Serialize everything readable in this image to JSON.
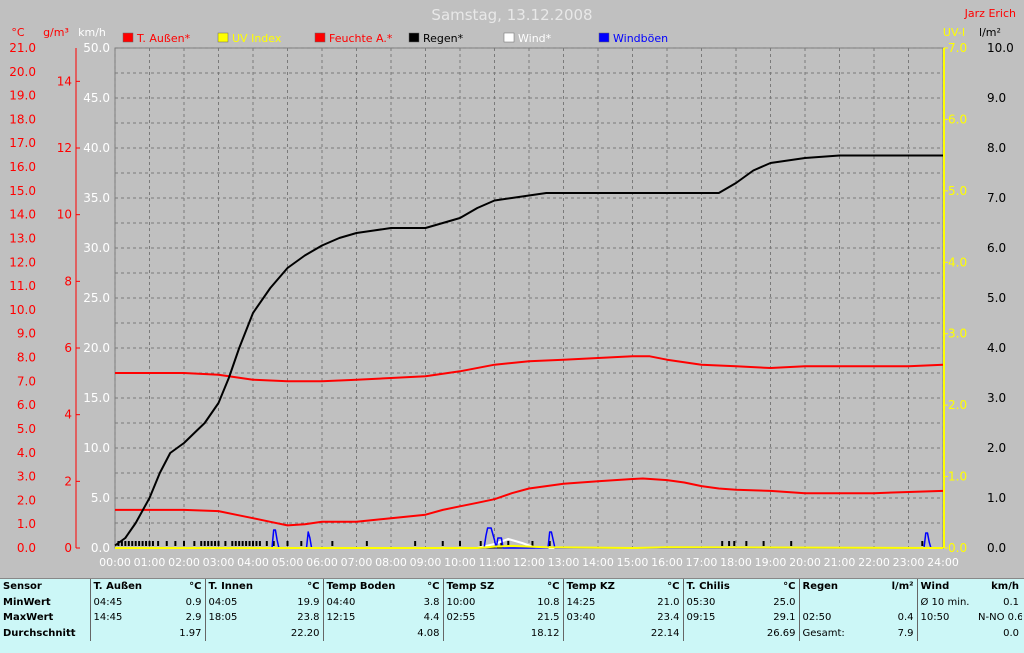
{
  "chart_data": {
    "type": "line",
    "title": "Samstag, 13.12.2008",
    "author": "Jarz Erich",
    "x_ticks": [
      "00:00",
      "01:00",
      "02:00",
      "03:00",
      "04:00",
      "05:00",
      "06:00",
      "07:00",
      "08:00",
      "09:00",
      "10:00",
      "11:00",
      "12:00",
      "13:00",
      "14:00",
      "15:00",
      "16:00",
      "17:00",
      "18:00",
      "19:00",
      "20:00",
      "21:00",
      "22:00",
      "23:00",
      "24:00"
    ],
    "xlim": [
      0,
      24
    ],
    "axes": {
      "temp": {
        "unit": "°C",
        "ylim": [
          0,
          21
        ],
        "ticks": [
          "0.0",
          "1.0",
          "2.0",
          "3.0",
          "4.0",
          "5.0",
          "6.0",
          "7.0",
          "8.0",
          "9.0",
          "10.0",
          "11.0",
          "12.0",
          "13.0",
          "14.0",
          "15.0",
          "16.0",
          "17.0",
          "18.0",
          "19.0",
          "20.0",
          "21.0"
        ],
        "color": "#ff0000"
      },
      "humidity": {
        "unit": "g/m³",
        "ylim": [
          0,
          15
        ],
        "ticks": [
          "0",
          "2",
          "4",
          "6",
          "8",
          "10",
          "12",
          "14"
        ],
        "color": "#ff0000"
      },
      "wind": {
        "unit": "km/h",
        "ylim": [
          0,
          50
        ],
        "ticks": [
          "0.0",
          "5.0",
          "10.0",
          "15.0",
          "20.0",
          "25.0",
          "30.0",
          "35.0",
          "40.0",
          "45.0",
          "50.0"
        ],
        "color": "#ffffff"
      },
      "uv": {
        "unit": "UV-I",
        "ylim": [
          0,
          7
        ],
        "ticks": [
          "0.0",
          "1.0",
          "2.0",
          "3.0",
          "4.0",
          "5.0",
          "6.0",
          "7.0"
        ],
        "color": "#ffff00"
      },
      "rain": {
        "unit": "l/m²",
        "ylim": [
          0,
          10
        ],
        "ticks": [
          "0.0",
          "1.0",
          "2.0",
          "3.0",
          "4.0",
          "5.0",
          "6.0",
          "7.0",
          "8.0",
          "9.0",
          "10.0"
        ],
        "color": "#000000"
      }
    },
    "legend": [
      "T. Außen*",
      "UV Index",
      "Feuchte A.*",
      "Regen*",
      "Wind*",
      "Windböen"
    ],
    "series": [
      {
        "name": "T. Außen*",
        "color": "#ff0000",
        "axis": "temp",
        "x": [
          0,
          1,
          2,
          3,
          3.5,
          4,
          4.5,
          5,
          5.5,
          6,
          7,
          8,
          9,
          9.5,
          10,
          10.5,
          11,
          11.5,
          12,
          12.5,
          13,
          14,
          15,
          15.3,
          16,
          16.5,
          17,
          17.5,
          18,
          19,
          20,
          21,
          22,
          23,
          24
        ],
        "y": [
          1.6,
          1.6,
          1.6,
          1.55,
          1.4,
          1.25,
          1.1,
          0.95,
          1.0,
          1.1,
          1.1,
          1.25,
          1.4,
          1.6,
          1.75,
          1.9,
          2.05,
          2.3,
          2.5,
          2.6,
          2.7,
          2.8,
          2.9,
          2.92,
          2.85,
          2.75,
          2.6,
          2.5,
          2.45,
          2.4,
          2.3,
          2.3,
          2.3,
          2.35,
          2.4
        ]
      },
      {
        "name": "Feuchte A.*",
        "color": "#ff0000",
        "axis": "humidity",
        "x": [
          0,
          1,
          2,
          3,
          4,
          5,
          6,
          7,
          8,
          9,
          10,
          11,
          12,
          13,
          14,
          15,
          15.5,
          16,
          17,
          18,
          19,
          20,
          21,
          22,
          23,
          24
        ],
        "y": [
          5.25,
          5.25,
          5.25,
          5.2,
          5.05,
          5.0,
          5.0,
          5.05,
          5.1,
          5.15,
          5.3,
          5.5,
          5.6,
          5.65,
          5.7,
          5.75,
          5.75,
          5.65,
          5.5,
          5.45,
          5.4,
          5.45,
          5.45,
          5.45,
          5.45,
          5.5
        ]
      },
      {
        "name": "Regen*",
        "color": "#000000",
        "axis": "rain",
        "x": [
          0,
          0.3,
          0.6,
          1.0,
          1.3,
          1.6,
          2.0,
          2.3,
          2.6,
          3.0,
          3.3,
          3.6,
          4.0,
          4.5,
          5.0,
          5.5,
          6.0,
          6.5,
          7.0,
          7.5,
          8.0,
          9.0,
          9.5,
          10.0,
          10.5,
          11.0,
          11.5,
          12.0,
          12.5,
          13.0,
          14.0,
          15.0,
          16.0,
          17.0,
          17.5,
          18.0,
          18.5,
          19.0,
          20.0,
          21.0,
          22.0,
          23.0,
          24.0
        ],
        "y": [
          0.05,
          0.2,
          0.5,
          1.0,
          1.5,
          1.9,
          2.1,
          2.3,
          2.5,
          2.9,
          3.4,
          4.0,
          4.7,
          5.2,
          5.6,
          5.85,
          6.05,
          6.2,
          6.3,
          6.35,
          6.4,
          6.4,
          6.5,
          6.6,
          6.8,
          6.95,
          7.0,
          7.05,
          7.1,
          7.1,
          7.1,
          7.1,
          7.1,
          7.1,
          7.1,
          7.3,
          7.55,
          7.7,
          7.8,
          7.85,
          7.85,
          7.85,
          7.85
        ]
      },
      {
        "name": "Wind*",
        "color": "#ffffff",
        "axis": "wind",
        "x": [
          0,
          10.5,
          11.0,
          11.4,
          11.8,
          12.2,
          24
        ],
        "y": [
          0,
          0,
          0.4,
          0.9,
          0.5,
          0,
          0
        ]
      },
      {
        "name": "Windböen",
        "color": "#0000ff",
        "axis": "wind",
        "x": [
          4.55,
          4.6,
          4.65,
          4.7,
          4.75,
          5.55,
          5.6,
          5.65,
          5.7,
          10.7,
          10.75,
          10.8,
          10.9,
          11.0,
          11.05,
          11.1,
          11.2,
          11.25,
          11.3,
          11.35,
          12.55,
          12.6,
          12.65,
          12.7,
          12.75,
          23.45,
          23.5,
          23.55,
          23.6,
          23.65
        ],
        "y": [
          0,
          1.8,
          1.8,
          0.8,
          0,
          0,
          1.6,
          1.0,
          0,
          0,
          1.2,
          2.0,
          2.0,
          0.8,
          0,
          1.0,
          1.0,
          0,
          0,
          0,
          0,
          1.6,
          1.6,
          0.8,
          0,
          0,
          1.5,
          1.5,
          0.6,
          0
        ]
      },
      {
        "name": "UV Index",
        "color": "#ffff00",
        "axis": "uv",
        "x": [
          0,
          10.5,
          11.0,
          11.5,
          12.0,
          12.5,
          15.0,
          16.0,
          24
        ],
        "y": [
          0,
          0,
          0.02,
          0.03,
          0.02,
          0.01,
          0,
          0.01,
          0
        ]
      }
    ],
    "rain_events_x": [
      0.1,
      0.2,
      0.3,
      0.4,
      0.5,
      0.6,
      0.7,
      0.8,
      0.9,
      1.0,
      1.1,
      1.25,
      1.5,
      1.75,
      2.0,
      2.3,
      2.5,
      2.6,
      2.7,
      2.8,
      2.9,
      3.0,
      3.2,
      3.4,
      3.5,
      3.6,
      3.7,
      3.8,
      3.9,
      4.0,
      4.1,
      4.2,
      4.4,
      4.6,
      5.0,
      5.4,
      6.3,
      7.3,
      8.7,
      9.5,
      10.0,
      10.6,
      11.2,
      11.4,
      12.1,
      12.6,
      17.6,
      17.8,
      17.95,
      18.3,
      18.8,
      19.6,
      23.4
    ],
    "grid": true
  },
  "table": {
    "row_labels": [
      "Sensor",
      "MinWert",
      "MaxWert",
      "Durchschnitt"
    ],
    "sensors": [
      {
        "name": "T. Außen",
        "unit": "°C",
        "min_time": "04:45",
        "min": "0.9",
        "max_time": "14:45",
        "max": "2.9",
        "avg": "1.97"
      },
      {
        "name": "T. Innen",
        "unit": "°C",
        "min_time": "04:05",
        "min": "19.9",
        "max_time": "18:05",
        "max": "23.8",
        "avg": "22.20"
      },
      {
        "name": "Temp Boden",
        "unit": "°C",
        "min_time": "04:40",
        "min": "3.8",
        "max_time": "12:15",
        "max": "4.4",
        "avg": "4.08"
      },
      {
        "name": "Temp SZ",
        "unit": "°C",
        "min_time": "10:00",
        "min": "10.8",
        "max_time": "02:55",
        "max": "21.5",
        "avg": "18.12"
      },
      {
        "name": "Temp KZ",
        "unit": "°C",
        "min_time": "14:25",
        "min": "21.0",
        "max_time": "03:40",
        "max": "23.4",
        "avg": "22.14"
      },
      {
        "name": "T. Chilis",
        "unit": "°C",
        "min_time": "05:30",
        "min": "25.0",
        "max_time": "09:15",
        "max": "29.1",
        "avg": "26.69"
      }
    ],
    "rain": {
      "name": "Regen",
      "unit": "l/m²",
      "min_time": "",
      "min": "",
      "max_time": "02:50",
      "max": "0.4",
      "total_label": "Gesamt:",
      "total": "7.9"
    },
    "wind": {
      "name": "Wind",
      "unit": "km/h",
      "min_time": "Ø 10 min.",
      "min": "0.1",
      "max_time": "10:50",
      "max": "N-NO 0.6",
      "avg": "0.0"
    }
  }
}
